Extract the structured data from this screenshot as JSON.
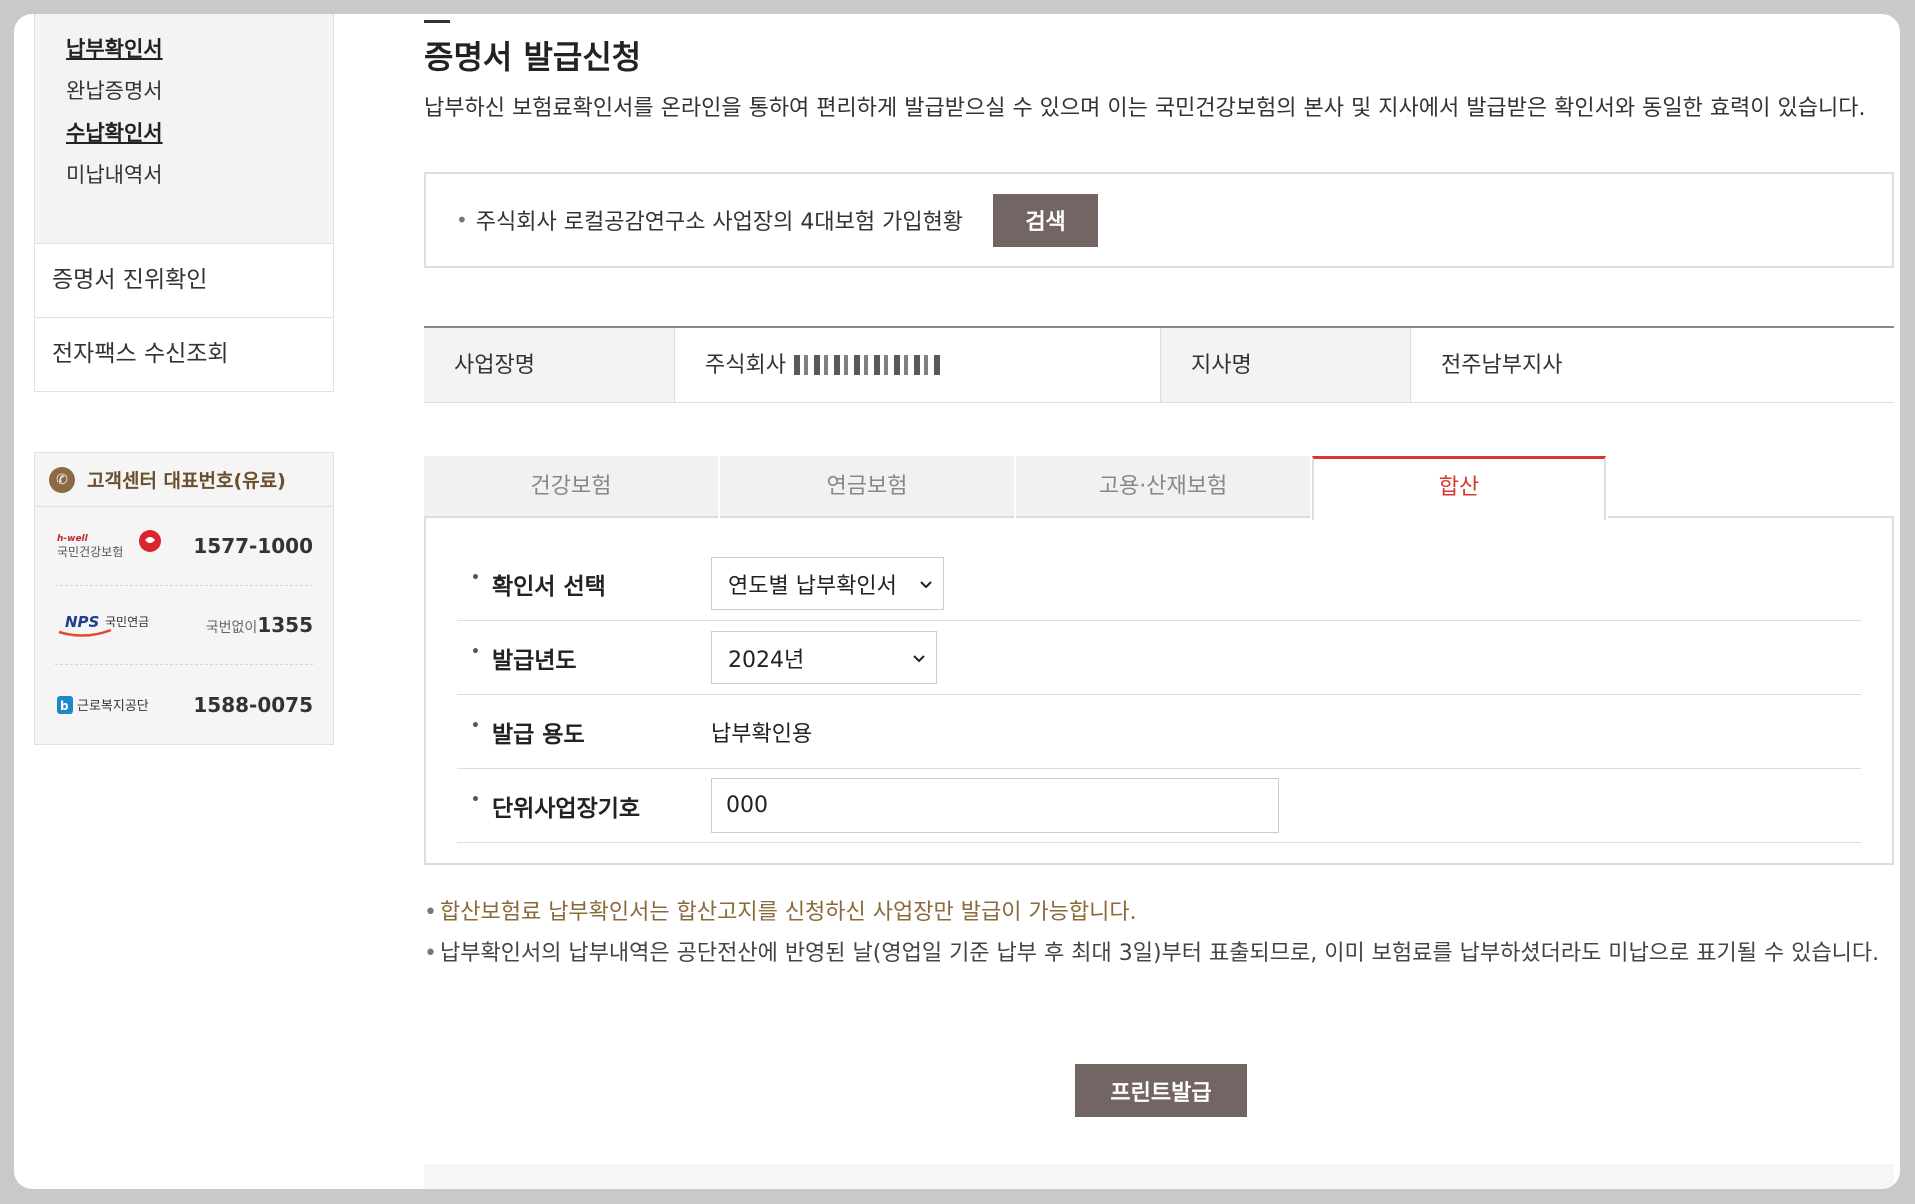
{
  "sidebar": {
    "subnav": [
      {
        "label": "납부확인서",
        "active": true
      },
      {
        "label": "완납증명서",
        "active": false
      },
      {
        "label": "수납확인서",
        "active": true
      },
      {
        "label": "미납내역서",
        "active": false
      }
    ],
    "menu": [
      "증명서 진위확인",
      "전자팩스 수신조회"
    ],
    "callcenter": {
      "title": "고객센터 대표번호(유료)",
      "rows": [
        {
          "org": "국민건강보험",
          "org_sub": "h-well",
          "number": "1577-1000",
          "prefix": ""
        },
        {
          "org": "국민연금",
          "org_sub": "NPS",
          "number": "1355",
          "prefix": "국번없이"
        },
        {
          "org": "근로복지공단",
          "org_sub": "",
          "number": "1588-0075",
          "prefix": ""
        }
      ]
    }
  },
  "main": {
    "title": "증명서 발급신청",
    "description": "납부하신 보험료확인서를 온라인을 통하여 편리하게 발급받으실 수 있으며 이는 국민건강보험의 본사 및 지사에서 발급받은 확인서와 동일한 효력이 있습니다.",
    "search": {
      "text": "주식회사 로컬공감연구소 사업장의 4대보험 가입현황",
      "button": "검색"
    },
    "info": {
      "biz_label": "사업장명",
      "biz_value_prefix": "주식회사",
      "branch_label": "지사명",
      "branch_value": "전주남부지사"
    },
    "tabs": [
      {
        "label": "건강보험",
        "active": false
      },
      {
        "label": "연금보험",
        "active": false
      },
      {
        "label": "고용·산재보험",
        "active": false
      },
      {
        "label": "합산",
        "active": true
      }
    ],
    "form": {
      "type_label": "확인서 선택",
      "type_value": "연도별 납부확인서",
      "year_label": "발급년도",
      "year_value": "2024년",
      "purpose_label": "발급 용도",
      "purpose_value": "납부확인용",
      "unit_label": "단위사업장기호",
      "unit_value": "000"
    },
    "notes": [
      "합산보험료 납부확인서는 합산고지를 신청하신 사업장만 발급이 가능합니다.",
      "납부확인서의 납부내역은 공단전산에 반영된 날(영업일 기준 납부 후 최대 3일)부터 표출되므로, 이미 보험료를 납부하셨더라도 미납으로 표기될 수 있습니다."
    ],
    "print_button": "프린트발급"
  },
  "colors": {
    "brand_button": "#726563",
    "active_tab": "#d8362e",
    "note_brown": "#8a6a3b"
  }
}
